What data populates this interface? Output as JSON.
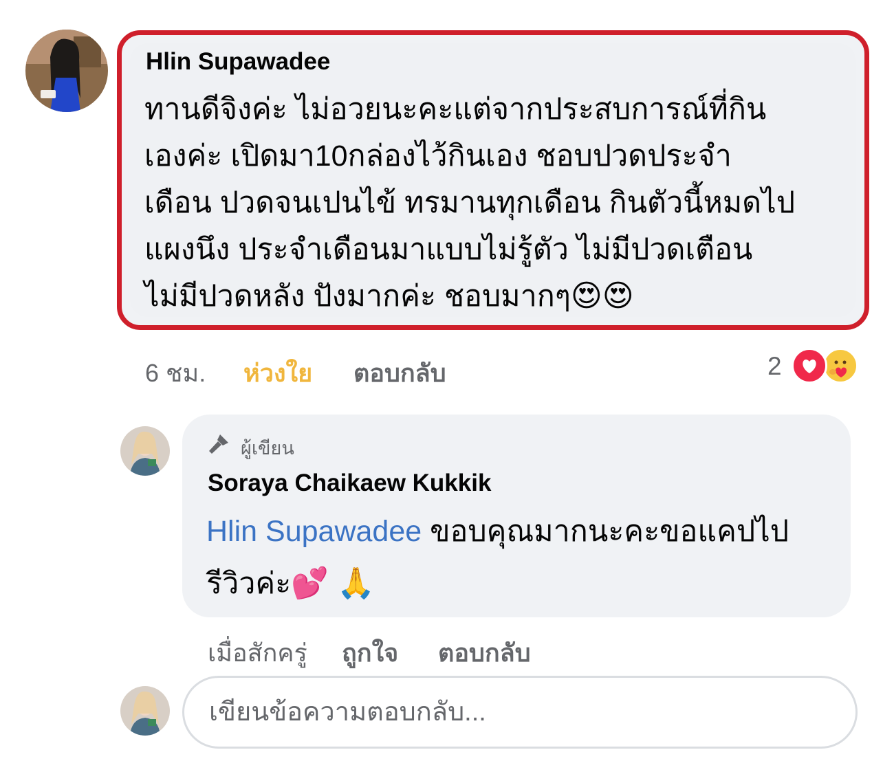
{
  "comment": {
    "author": "Hlin Supawadee",
    "lines": [
      "ทานดีจิงค่ะ ไม่อวยนะคะแต่จากประสบการณ์ที่กิน",
      "เองค่ะ เปิดมา10กล่องไว้กินเอง ชอบปวดประจำ",
      "เดือน ปวดจนเปนไข้ ทรมานทุกเดือน กินตัวนี้หมดไป",
      "แผงนึง ประจำเดือนมาแบบไม่รู้ตัว ไม่มีปวดเตือน",
      "ไม่มีปวดหลัง ปังมากค่ะ ชอบมากๆ"
    ],
    "emojis": "😍😍",
    "time": "6 ชม.",
    "care_label": "ห่วงใย",
    "reply_label": "ตอบกลับ",
    "reaction_count": "2",
    "reactions": [
      "love-icon",
      "care-icon"
    ]
  },
  "reply": {
    "badge_label": "ผู้เขียน",
    "badge_icon": "microphone-icon",
    "author": "Soraya Chaikaew Kukkik",
    "mention": "Hlin Supawadee",
    "text_line1": " ขอบคุณมากนะคะขอแคปไป",
    "text_line2": "รีวิวค่ะ",
    "emojis": "💕 🙏",
    "time": "เมื่อสักครู่",
    "like_label": "ถูกใจ",
    "reply_label": "ตอบกลับ"
  },
  "compose": {
    "placeholder": "เขียนข้อความตอบกลับ..."
  },
  "colors": {
    "highlight_border": "#cf1f2b",
    "bubble_bg": "#f0f2f5",
    "mention": "#3b73c4",
    "care": "#f0b63d",
    "secondary_text": "#65676b"
  }
}
